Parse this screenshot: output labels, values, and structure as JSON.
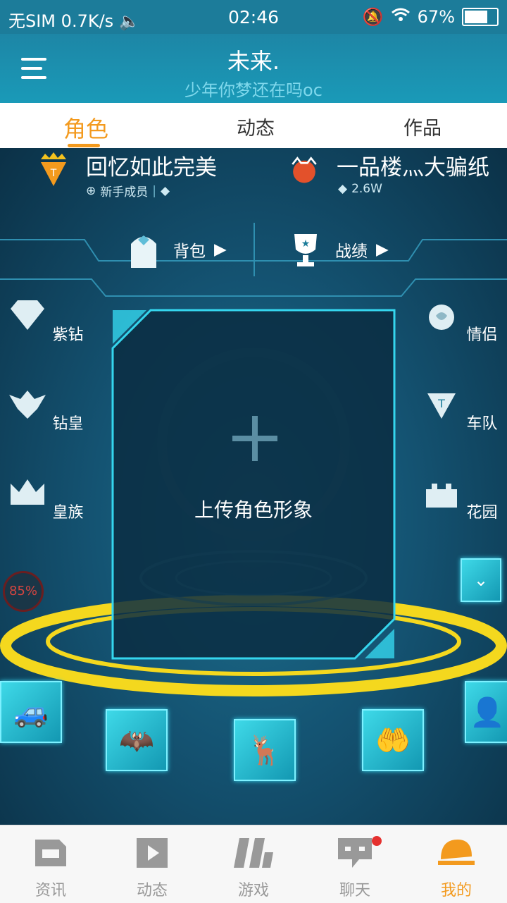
{
  "status": {
    "carrier": "无SIM",
    "speed": "0.7K/s",
    "time": "02:46",
    "battery": "67%"
  },
  "header": {
    "title": "未来.",
    "subtitle": "少年你梦还在吗oc"
  },
  "tabs": [
    {
      "label": "角色"
    },
    {
      "label": "动态"
    },
    {
      "label": "作品"
    }
  ],
  "profile": {
    "left": {
      "name": "回忆如此完美",
      "rank": "新手成员"
    },
    "right": {
      "name": "一品楼灬大骗纸",
      "value": "2.6W"
    }
  },
  "bar": {
    "backpack": "背包",
    "record": "战绩"
  },
  "side_left": [
    {
      "label": "紫钻"
    },
    {
      "label": "钻皇"
    },
    {
      "label": "皇族"
    }
  ],
  "side_right": [
    {
      "label": "情侣"
    },
    {
      "label": "车队"
    },
    {
      "label": "花园"
    }
  ],
  "center": {
    "upload": "上传角色形象"
  },
  "percent": "85%",
  "bottom_nav": [
    {
      "label": "资讯"
    },
    {
      "label": "动态"
    },
    {
      "label": "游戏"
    },
    {
      "label": "聊天"
    },
    {
      "label": "我的"
    }
  ],
  "colors": {
    "accent": "#f39a1e",
    "header": "#1d86a6",
    "cyan": "#35d6ee",
    "ring": "#f4d81e"
  }
}
